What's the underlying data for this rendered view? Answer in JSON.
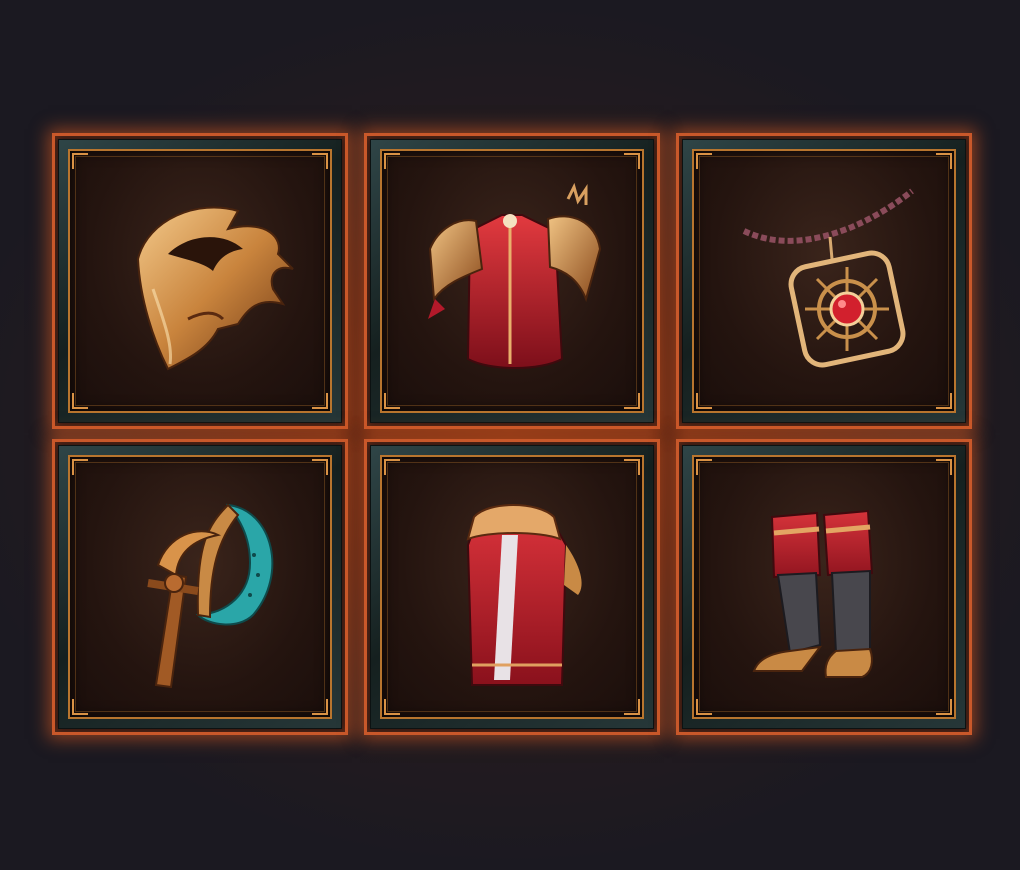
{
  "inventory": {
    "slots": [
      {
        "slot": "helm",
        "icon": "helm-icon"
      },
      {
        "slot": "chest",
        "icon": "chest-armor-icon"
      },
      {
        "slot": "amulet",
        "icon": "amulet-icon"
      },
      {
        "slot": "weapon",
        "icon": "scythe-axe-icon"
      },
      {
        "slot": "legs",
        "icon": "pants-icon"
      },
      {
        "slot": "boots",
        "icon": "boots-icon"
      }
    ]
  },
  "colors": {
    "frame_glow": "#c9582a",
    "gold_trim": "#b8752e",
    "crimson": "#b3192a",
    "teal_blade": "#2aa6a8"
  }
}
